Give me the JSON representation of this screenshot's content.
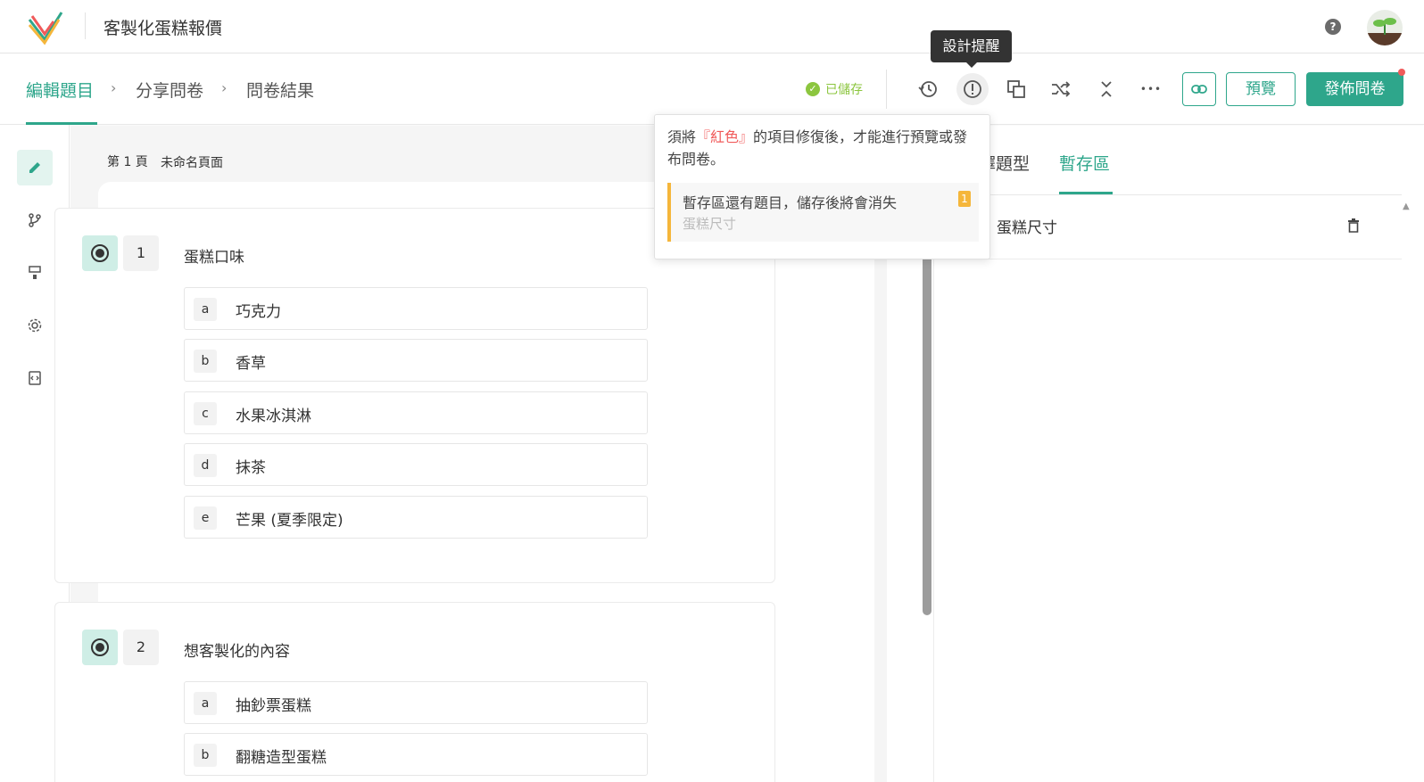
{
  "app": {
    "title": "客製化蛋糕報價",
    "help_label": "?"
  },
  "colors": {
    "brand": "#2ea68b",
    "saved": "#8cc63f",
    "warning": "#f5b63b",
    "error": "#f05a5a"
  },
  "breadcrumb": {
    "items": [
      "編輯題目",
      "分享問卷",
      "問卷結果"
    ],
    "separator": "›"
  },
  "toolbar": {
    "saved_label": "已儲存",
    "tooltip": "設計提醒",
    "preview_label": "預覽",
    "publish_label": "發佈問卷",
    "more_label": "•••"
  },
  "sidebar": {
    "items": [
      "edit-icon",
      "branch-icon",
      "paint-roller-icon",
      "gear-icon",
      "code-icon"
    ]
  },
  "page": {
    "label": "第 1 頁",
    "name": "未命名頁面"
  },
  "questions": [
    {
      "number": "1",
      "title": "蛋糕口味",
      "options": [
        {
          "key": "a",
          "text": "巧克力"
        },
        {
          "key": "b",
          "text": "香草"
        },
        {
          "key": "c",
          "text": "水果冰淇淋"
        },
        {
          "key": "d",
          "text": "抹茶"
        },
        {
          "key": "e",
          "text": "芒果 (夏季限定)"
        }
      ]
    },
    {
      "number": "2",
      "title": "想客製化的內容",
      "options": [
        {
          "key": "a",
          "text": "抽鈔票蛋糕"
        },
        {
          "key": "b",
          "text": "翻糖造型蛋糕"
        }
      ]
    }
  ],
  "right_panel": {
    "tabs": [
      "擇題型",
      "暫存區"
    ],
    "items": [
      "蛋糕尺寸"
    ]
  },
  "popover": {
    "message_before": "須將",
    "message_red": "『紅色』",
    "message_after": "的項目修復後，才能進行預覽或發布問卷。",
    "warning_title": "暫存區還有題目，儲存後將會消失",
    "warning_sub": "蛋糕尺寸",
    "warning_count": "1"
  }
}
